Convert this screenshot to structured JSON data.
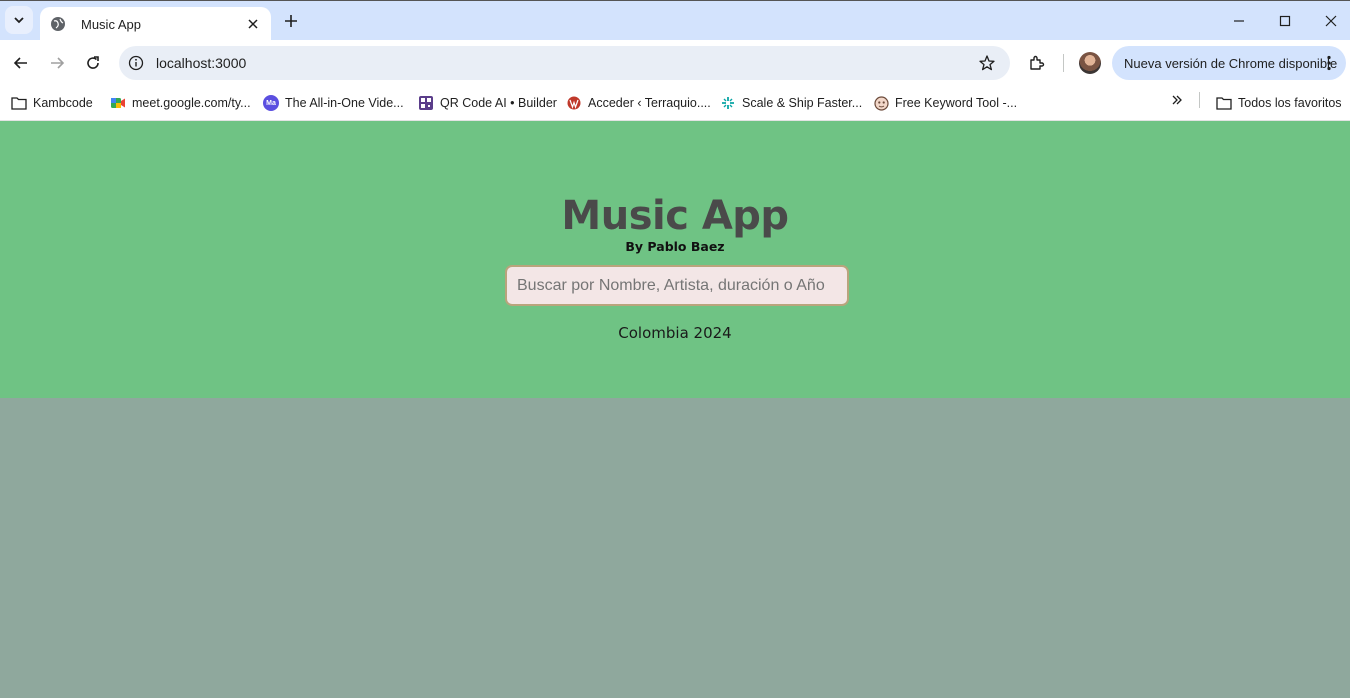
{
  "browser": {
    "tab": {
      "title": "Music App"
    },
    "address": {
      "url": "localhost:3000"
    },
    "update_chip": {
      "label": "Nueva versión de Chrome disponible"
    },
    "bookmarks": [
      {
        "label": "Kambcode",
        "icon": "folder-icon"
      },
      {
        "label": "meet.google.com/ty...",
        "icon": "google-meet-icon"
      },
      {
        "label": "The All-in-One Vide...",
        "icon": "ma-logo-icon"
      },
      {
        "label": "QR Code AI • Builder",
        "icon": "qr-code-icon"
      },
      {
        "label": "Acceder ‹ Terraquio....",
        "icon": "wordpress-icon"
      },
      {
        "label": "Scale & Ship Faster...",
        "icon": "figma-icon"
      },
      {
        "label": "Free Keyword Tool -...",
        "icon": "keyword-tool-icon"
      }
    ],
    "all_bookmarks": {
      "label": "Todos los favoritos",
      "icon": "folder-icon"
    }
  },
  "page": {
    "title": "Music App",
    "subtitle": "By Pablo Baez",
    "search": {
      "placeholder": "Buscar por Nombre, Artista, duración o Año",
      "value": ""
    },
    "footer": "Colombia 2024"
  },
  "colors": {
    "hero_bg": "#6fc384",
    "page_bg": "#8fa89d",
    "title": "#4a4a4a",
    "search_bg": "#f3e6e6",
    "search_border": "#b9a47c"
  }
}
